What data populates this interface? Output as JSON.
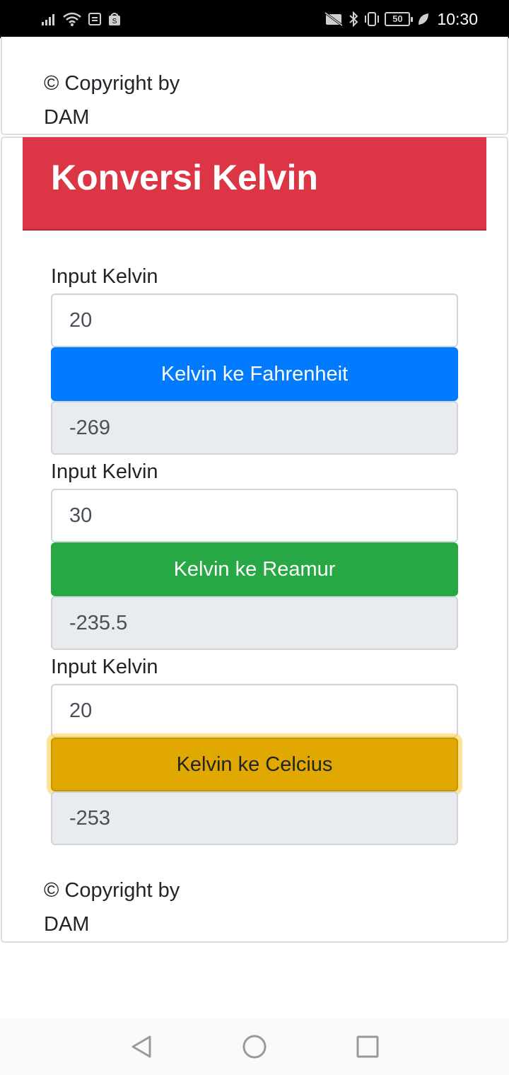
{
  "status_bar": {
    "time": "10:30",
    "battery_level": "50",
    "left_icons": [
      "signal-icon",
      "wifi-icon",
      "notification-icon",
      "shop-icon"
    ],
    "right_icons": [
      "no-sim-icon",
      "bluetooth-icon",
      "vibrate-icon",
      "battery-icon",
      "leaf-icon"
    ]
  },
  "top_footer": {
    "copyright_line1": "© Copyright by",
    "copyright_line2": "DAM"
  },
  "header": {
    "title": "Konversi Kelvin",
    "background": "#dc3545"
  },
  "converters": [
    {
      "label": "Input Kelvin",
      "input_value": "20",
      "button_label": "Kelvin ke Fahrenheit",
      "button_color": "#007bff",
      "result": "-269"
    },
    {
      "label": "Input Kelvin",
      "input_value": "30",
      "button_label": "Kelvin ke Reamur",
      "button_color": "#28a745",
      "result": "-235.5"
    },
    {
      "label": "Input Kelvin",
      "input_value": "20",
      "button_label": "Kelvin ke Celcius",
      "button_color": "#e0a800",
      "result": "-253"
    }
  ],
  "bottom_footer": {
    "copyright_line1": "© Copyright by",
    "copyright_line2": "DAM"
  },
  "nav_bar": {
    "icons": [
      "back-icon",
      "home-icon",
      "recents-icon"
    ]
  }
}
